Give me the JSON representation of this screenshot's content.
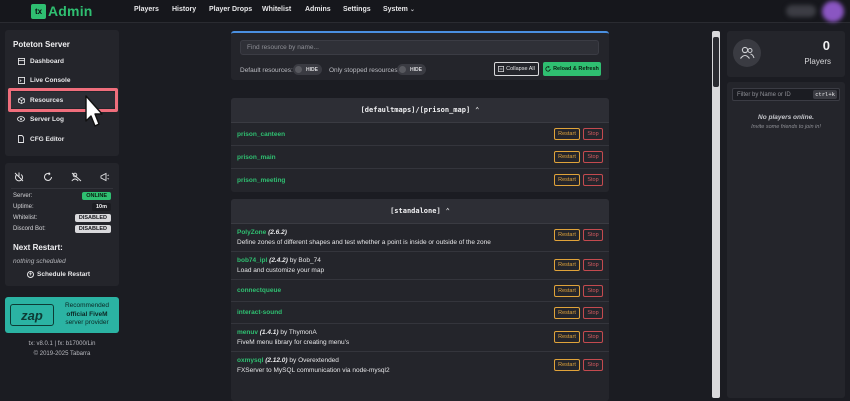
{
  "nav": {
    "logo_mark": "tx",
    "logo_text": "Admin",
    "items": [
      {
        "label": "Players"
      },
      {
        "label": "History"
      },
      {
        "label": "Player Drops"
      },
      {
        "label": "Whitelist"
      },
      {
        "label": "Admins"
      },
      {
        "label": "Settings"
      },
      {
        "label": "System"
      }
    ]
  },
  "sidebar": {
    "server_name": "Poteton Server",
    "menu": [
      {
        "label": "Dashboard",
        "icon": "dashboard-icon"
      },
      {
        "label": "Live Console",
        "icon": "terminal-icon"
      },
      {
        "label": "Resources",
        "icon": "box-icon"
      },
      {
        "label": "Server Log",
        "icon": "eye-icon"
      },
      {
        "label": "CFG Editor",
        "icon": "file-icon"
      }
    ],
    "status": {
      "server_label": "Server:",
      "server_value": "ONLINE",
      "uptime_label": "Uptime:",
      "uptime_value": "10m",
      "whitelist_label": "Whitelist:",
      "whitelist_value": "DISABLED",
      "discord_label": "Discord Bot:",
      "discord_value": "DISABLED"
    },
    "next_restart_title": "Next Restart:",
    "next_restart_value": "nothing scheduled",
    "schedule_button": "Schedule Restart",
    "promo": {
      "logo": "zap",
      "line1": "Recommended",
      "line2": "official FiveM",
      "line3": "server provider"
    },
    "version": "tx: v8.0.1 | fx: b17000/Lin",
    "copyright": "© 2019-2025 Tabarra"
  },
  "resources": {
    "search_placeholder": "Find resource by name...",
    "default_label": "Default resources:",
    "default_toggle": "HIDE",
    "stopped_label": "Only stopped resources:",
    "stopped_toggle": "HIDE",
    "collapse_label": "Collapse All",
    "reload_label": "Reload & Refresh",
    "restart_label": "Restart",
    "stop_label": "Stop",
    "groups": [
      {
        "name": "[defaultmaps]/[prison_map]",
        "items": [
          {
            "name": "prison_canteen"
          },
          {
            "name": "prison_main"
          },
          {
            "name": "prison_meeting"
          }
        ]
      },
      {
        "name": "[standalone]",
        "items": [
          {
            "name": "PolyZone",
            "version": "(2.6.2)",
            "author": "",
            "desc": "Define zones of different shapes and test whether a point is inside or outside of the zone"
          },
          {
            "name": "bob74_ipl",
            "version": "(2.4.2)",
            "author": "by Bob_74",
            "desc": "Load and customize your map"
          },
          {
            "name": "connectqueue"
          },
          {
            "name": "interact-sound"
          },
          {
            "name": "menuv",
            "version": "(1.4.1)",
            "author": "by ThymonA",
            "desc": "FiveM menu library for creating menu's"
          },
          {
            "name": "oxmysql",
            "version": "(2.12.0)",
            "author": "by Overextended",
            "desc": "FXServer to MySQL communication via node-mysql2"
          }
        ]
      }
    ]
  },
  "players": {
    "count": "0",
    "label": "Players",
    "filter_placeholder": "Filter by Name or ID",
    "shortcut": "ctrl+k",
    "empty_title": "No players online.",
    "empty_hint": "Invite some friends to join in!"
  }
}
